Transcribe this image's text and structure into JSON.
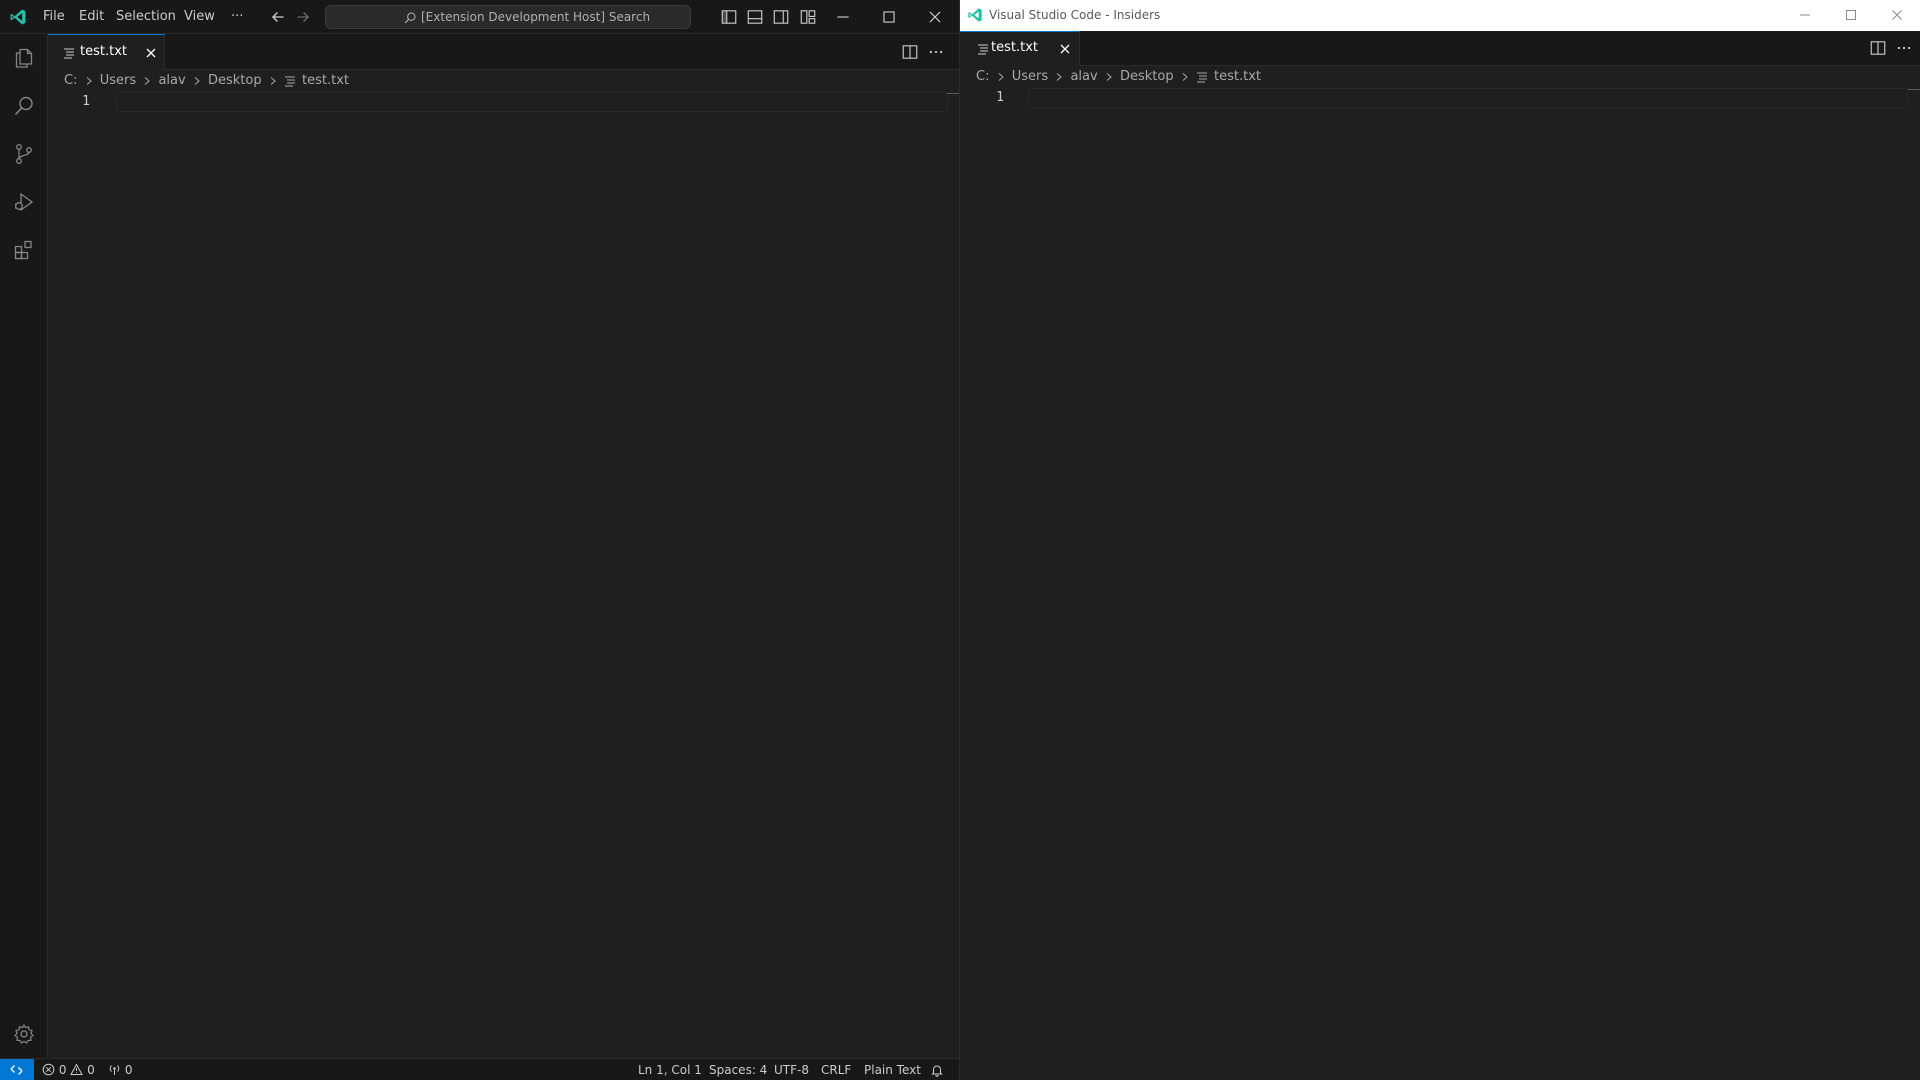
{
  "left_window": {
    "menu": [
      "File",
      "Edit",
      "Selection",
      "View"
    ],
    "more_menu_label": "···",
    "command_center": {
      "text": "[Extension Development Host] Search"
    },
    "tab": {
      "label": "test.txt"
    },
    "breadcrumb": [
      "C:",
      "Users",
      "alav",
      "Desktop",
      "test.txt"
    ],
    "editor": {
      "line_numbers": [
        "1"
      ]
    },
    "statusbar": {
      "errors": "0",
      "warnings": "0",
      "ports": "0",
      "cursor": "Ln 1, Col 1",
      "indent": "Spaces: 4",
      "encoding": "UTF-8",
      "eol": "CRLF",
      "language": "Plain Text"
    }
  },
  "right_window": {
    "title": "Visual Studio Code - Insiders",
    "tab": {
      "label": "test.txt"
    },
    "breadcrumb": [
      "C:",
      "Users",
      "alav",
      "Desktop",
      "test.txt"
    ],
    "editor": {
      "line_numbers": [
        "1"
      ]
    }
  },
  "icons": {
    "activity_bar": [
      "files-icon",
      "search-icon",
      "source-control-icon",
      "run-debug-icon",
      "extensions-icon",
      "gear-icon"
    ],
    "window_controls": [
      "minimize-icon",
      "maximize-icon",
      "close-icon"
    ]
  },
  "colors": {
    "accent": "#0078d4",
    "editor_bg": "#1f1f1f",
    "chrome_bg": "#181818",
    "vscode_logo": "#24bfa5",
    "insiders_logo": "#24bfa5"
  }
}
